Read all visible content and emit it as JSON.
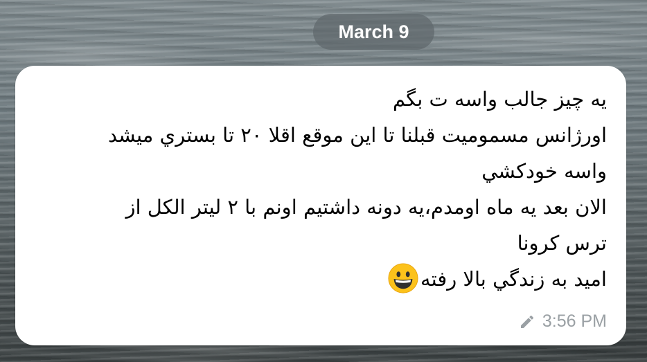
{
  "chat": {
    "date_label": "March 9"
  },
  "message": {
    "lines": [
      "یه چیز جالب واسه ت بگم",
      "اورژانس مسمومیت قبلنا تا این موقع اقلا ۲۰ تا بستري میشد",
      "واسه خودکشي",
      "الان بعد یه ماه اومدم،یه دونه داشتیم اونم با ۲ لیتر الکل از",
      "ترس کرونا",
      "امید به زندگي بالا رفته"
    ],
    "emoji": "grinning-face-emoji",
    "time": "3:56 PM",
    "edited_icon": "pencil-icon"
  },
  "colors": {
    "bubble": "#ffffff",
    "meta_text": "#9aa0a4",
    "date_chip_bg": "#60686c"
  }
}
